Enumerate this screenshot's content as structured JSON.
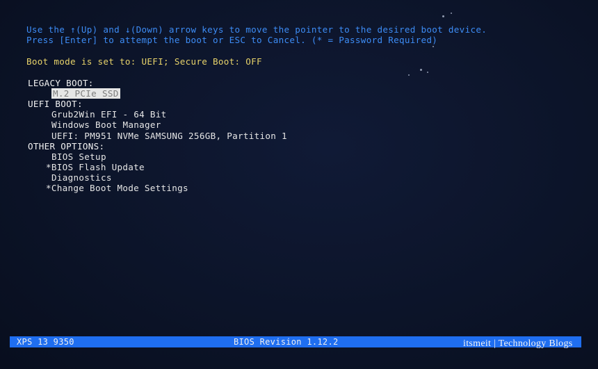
{
  "instructions": {
    "line1": "Use the ↑(Up) and ↓(Down) arrow keys to move the pointer to the desired boot device.",
    "line2": "Press [Enter] to attempt the boot or ESC to Cancel. (* = Password Required)"
  },
  "boot_mode": "Boot mode is set to: UEFI; Secure Boot: OFF",
  "legacy_boot": {
    "header": "LEGACY BOOT:",
    "items": [
      "M.2 PCIe SSD"
    ],
    "selected_index": 0
  },
  "uefi_boot": {
    "header": "UEFI BOOT:",
    "items": [
      "Grub2Win EFI - 64 Bit",
      "Windows Boot Manager",
      "UEFI: PM951 NVMe SAMSUNG 256GB, Partition 1"
    ]
  },
  "other_options": {
    "header": "OTHER OPTIONS:",
    "items": [
      "BIOS Setup",
      "*BIOS Flash Update",
      "Diagnostics",
      "*Change Boot Mode Settings"
    ]
  },
  "footer": {
    "model": "XPS 13 9350",
    "bios_revision": "BIOS Revision 1.12.2"
  },
  "watermark": "itsmeit | Technology Blogs",
  "colors": {
    "background": "#0c1429",
    "instruction_text": "#3d8cf5",
    "boot_mode_text": "#e8d36a",
    "menu_text": "#e6e6e6",
    "footer_bar": "#1f6ef0"
  }
}
